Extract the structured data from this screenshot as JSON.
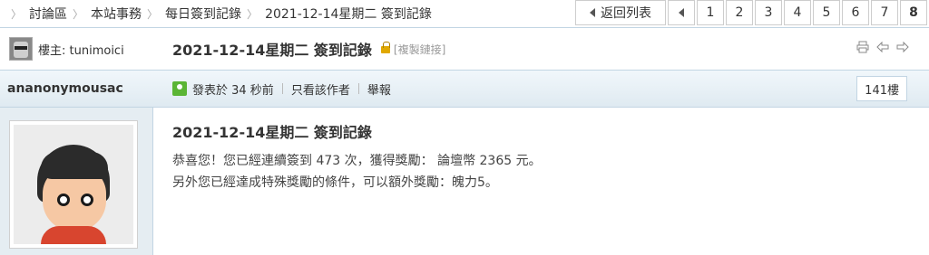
{
  "breadcrumb": [
    "討論區",
    "本站事務",
    "每日簽到記錄",
    "2021-12-14星期二 簽到記錄"
  ],
  "pager": {
    "back_label": "返回列表",
    "pages": [
      "1",
      "2",
      "3",
      "4",
      "5",
      "6",
      "7",
      "8"
    ],
    "current": "8"
  },
  "thread": {
    "owner_label": "樓主: tunimoici",
    "title": "2021-12-14星期二 簽到記錄",
    "copy_link": "[複製鏈接]"
  },
  "post": {
    "author": "ananonymousac",
    "posted": "發表於 34 秒前",
    "author_only": "只看該作者",
    "report": "舉報",
    "floor": "141樓",
    "title": "2021-12-14星期二 簽到記錄",
    "line1": "恭喜您！您已經連續簽到 473 次，獲得獎勵： 論壇幣 2365 元。",
    "line2": "另外您已經達成特殊獎勵的條件，可以額外獎勵：魄力5。"
  },
  "icons": [
    "print-icon",
    "prev-thread-icon",
    "next-thread-icon",
    "lock-icon",
    "user-icon"
  ]
}
